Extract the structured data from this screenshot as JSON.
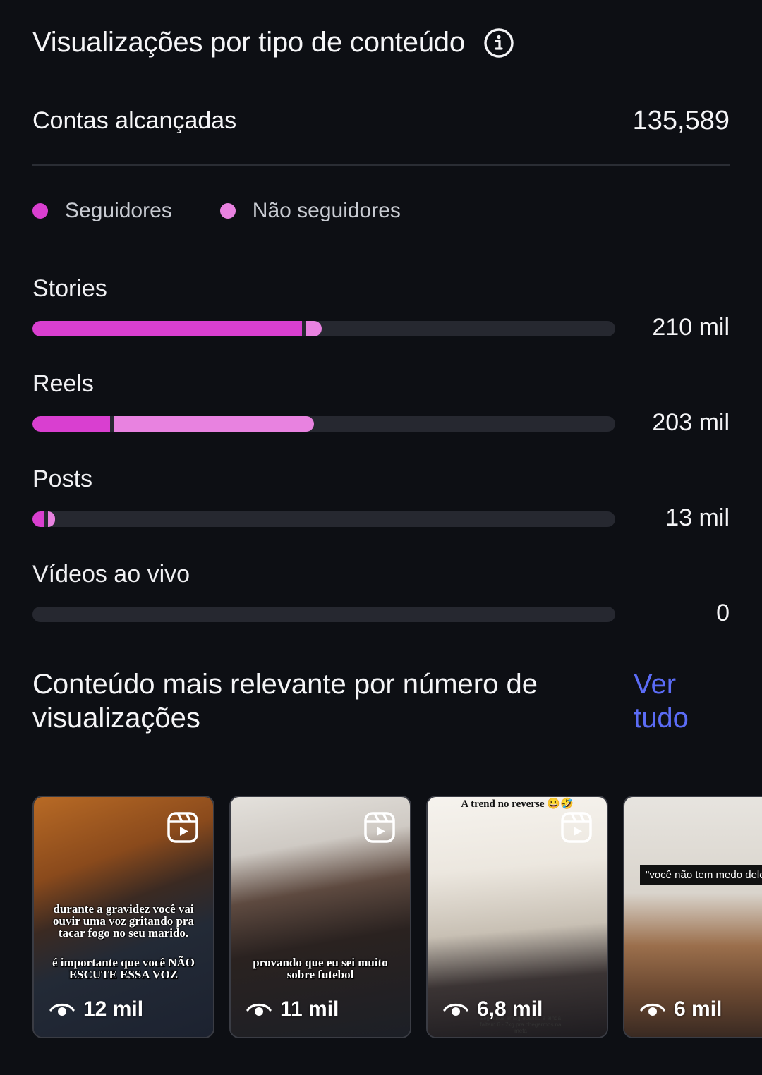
{
  "header": {
    "title": "Visualizações por tipo de conteúdo"
  },
  "reach": {
    "label": "Contas alcançadas",
    "value": "135,589"
  },
  "legend": [
    {
      "label": "Seguidores",
      "color": "#d93fd0"
    },
    {
      "label": "Não seguidores",
      "color": "#e882e0"
    }
  ],
  "colors": {
    "followers": "#d93fd0",
    "non_followers": "#e882e0",
    "track": "#262830",
    "link": "#5b6cf6"
  },
  "metrics": [
    {
      "label": "Stories",
      "value": "210 mil",
      "followers_fraction": 0.463,
      "non_followers_fraction": 0.027
    },
    {
      "label": "Reels",
      "value": "203 mil",
      "followers_fraction": 0.133,
      "non_followers_fraction": 0.343
    },
    {
      "label": "Posts",
      "value": "13 mil",
      "followers_fraction": 0.019,
      "non_followers_fraction": 0.012
    },
    {
      "label": "Vídeos ao vivo",
      "value": "0",
      "followers_fraction": 0,
      "non_followers_fraction": 0
    }
  ],
  "top_content": {
    "title": "Conteúdo mais relevante por número de visualizações",
    "see_all": "Ver tudo",
    "items": [
      {
        "views": "12 mil",
        "caption_1": "durante a gravidez você vai ouvir uma voz gritando pra tacar fogo no seu marido.",
        "caption_2": "é importante que você NÃO ESCUTE ESSA VOZ"
      },
      {
        "views": "11 mil",
        "caption_1": "provando que eu sei muito sobre futebol"
      },
      {
        "views": "6,8 mil",
        "top_note": "A trend no reverse 😀🤣",
        "bottom_note": "seguimos emagrecendo e ainda faltam 6 - 7kg pra chegarmos na meta"
      },
      {
        "views": "6 mil",
        "quote": "\"você não tem medo dele te"
      }
    ]
  }
}
